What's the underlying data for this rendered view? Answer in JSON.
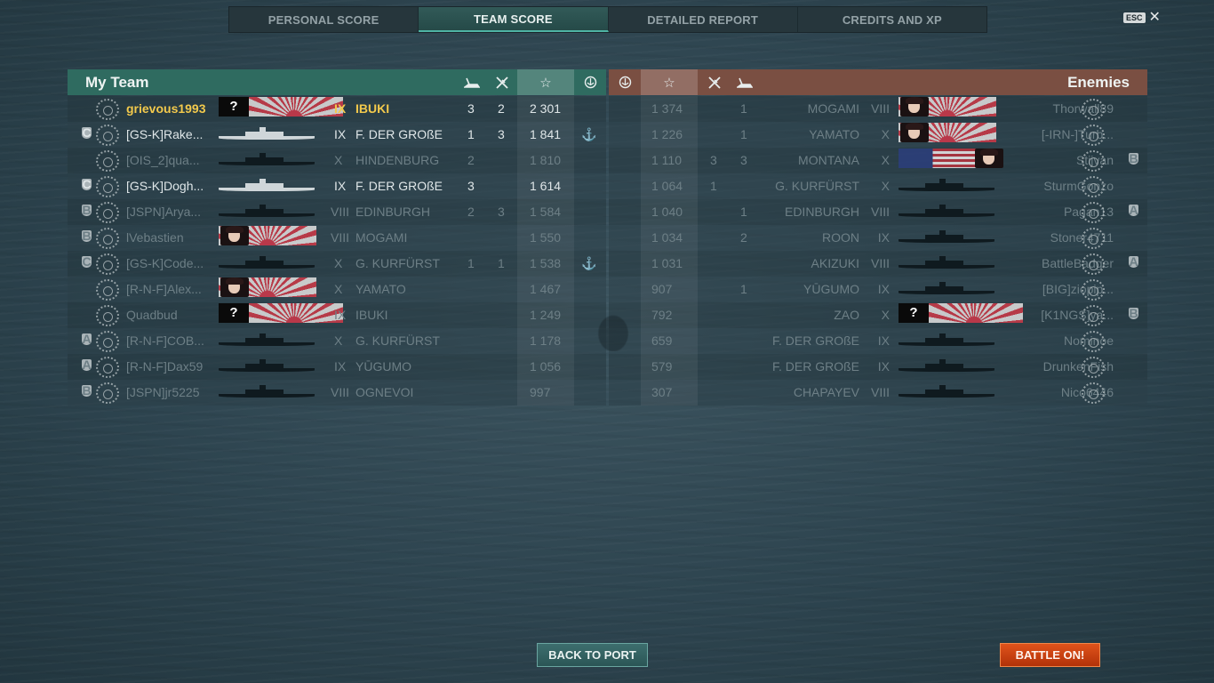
{
  "tabs": [
    {
      "label": "PERSONAL SCORE"
    },
    {
      "label": "TEAM SCORE"
    },
    {
      "label": "DETAILED REPORT"
    },
    {
      "label": "CREDITS AND XP"
    }
  ],
  "esc_key": "ESC",
  "close_glyph": "✕",
  "my_team": {
    "title": "My Team",
    "header_icons": [
      "torpedo-ship-icon",
      "plane-destroyed-icon",
      "star-icon",
      "base-capture-icon"
    ],
    "rows": [
      {
        "division": "",
        "name": "grievous1993",
        "tier": "IX",
        "ship": "IBUKI",
        "a": "3",
        "b": "2",
        "score": "2 301",
        "anchor": "",
        "alive": true,
        "me": true,
        "visual": "unknown-flag"
      },
      {
        "division": "C",
        "name": "[GS-K]Rake...",
        "tier": "IX",
        "ship": "F. DER GROßE",
        "a": "1",
        "b": "3",
        "score": "1 841",
        "anchor": "⚓",
        "alive": true,
        "visual": "silhouette"
      },
      {
        "division": "",
        "name": "[OIS_2]qua...",
        "tier": "X",
        "ship": "HINDENBURG",
        "a": "2",
        "b": "",
        "score": "1 810",
        "anchor": "",
        "alive": false,
        "visual": "silhouette"
      },
      {
        "division": "C",
        "name": "[GS-K]Dogh...",
        "tier": "IX",
        "ship": "F. DER GROßE",
        "a": "3",
        "b": "",
        "score": "1 614",
        "anchor": "",
        "alive": true,
        "visual": "silhouette"
      },
      {
        "division": "B",
        "name": "[JSPN]Arya...",
        "tier": "VIII",
        "ship": "EDINBURGH",
        "a": "2",
        "b": "3",
        "score": "1 584",
        "anchor": "",
        "alive": false,
        "visual": "silhouette"
      },
      {
        "division": "B",
        "name": "lVebastien",
        "tier": "VIII",
        "ship": "MOGAMI",
        "a": "",
        "b": "",
        "score": "1 550",
        "anchor": "",
        "alive": false,
        "visual": "portrait-flag"
      },
      {
        "division": "C",
        "name": "[GS-K]Code...",
        "tier": "X",
        "ship": "G. KURFÜRST",
        "a": "1",
        "b": "1",
        "score": "1 538",
        "anchor": "⚓",
        "alive": false,
        "visual": "silhouette"
      },
      {
        "division": "",
        "name": "[R-N-F]Alex...",
        "tier": "X",
        "ship": "YAMATO",
        "a": "",
        "b": "",
        "score": "1 467",
        "anchor": "",
        "alive": false,
        "visual": "portrait-flag"
      },
      {
        "division": "",
        "name": "Quadbud",
        "tier": "IX",
        "ship": "IBUKI",
        "a": "",
        "b": "",
        "score": "1 249",
        "anchor": "",
        "alive": false,
        "visual": "unknown-flag"
      },
      {
        "division": "A",
        "name": "[R-N-F]COB...",
        "tier": "X",
        "ship": "G. KURFÜRST",
        "a": "",
        "b": "",
        "score": "1 178",
        "anchor": "",
        "alive": false,
        "visual": "silhouette"
      },
      {
        "division": "A",
        "name": "[R-N-F]Dax59",
        "tier": "IX",
        "ship": "YŪGUMO",
        "a": "",
        "b": "",
        "score": "1 056",
        "anchor": "",
        "alive": false,
        "visual": "silhouette"
      },
      {
        "division": "B",
        "name": "[JSPN]jr5225",
        "tier": "VIII",
        "ship": "OGNEVOI",
        "a": "",
        "b": "",
        "score": "997",
        "anchor": "",
        "alive": false,
        "visual": "silhouette"
      }
    ]
  },
  "enemies": {
    "title": "Enemies",
    "rows": [
      {
        "score": "1 374",
        "b": "",
        "a": "1",
        "ship": "MOGAMI",
        "tier": "VIII",
        "name": "Thorwall89",
        "division": "",
        "alive": false,
        "visual": "portrait-flag"
      },
      {
        "score": "1 226",
        "b": "",
        "a": "1",
        "ship": "YAMATO",
        "tier": "X",
        "name": "[-IRN-]Turb...",
        "division": "",
        "alive": false,
        "visual": "portrait-flag"
      },
      {
        "score": "1 110",
        "b": "3",
        "a": "3",
        "ship": "MONTANA",
        "tier": "X",
        "name": "Stijvan",
        "division": "B",
        "alive": false,
        "visual": "us-flag"
      },
      {
        "score": "1 064",
        "b": "1",
        "a": "",
        "ship": "G. KURFÜRST",
        "tier": "X",
        "name": "SturmGonzo",
        "division": "",
        "alive": false,
        "visual": "silhouette"
      },
      {
        "score": "1 040",
        "b": "",
        "a": "1",
        "ship": "EDINBURGH",
        "tier": "VIII",
        "name": "Pagan13",
        "division": "A",
        "alive": false,
        "visual": "silhouette"
      },
      {
        "score": "1 034",
        "b": "",
        "a": "2",
        "ship": "ROON",
        "tier": "IX",
        "name": "Stoner4711",
        "division": "",
        "alive": false,
        "visual": "silhouette"
      },
      {
        "score": "1 031",
        "b": "",
        "a": "",
        "ship": "AKIZUKI",
        "tier": "VIII",
        "name": "BattleBadger",
        "division": "A",
        "alive": false,
        "visual": "silhouette"
      },
      {
        "score": "907",
        "b": "",
        "a": "1",
        "ship": "YŪGUMO",
        "tier": "IX",
        "name": "[BIG]ziopip...",
        "division": "",
        "alive": false,
        "visual": "silhouette"
      },
      {
        "score": "792",
        "b": "",
        "a": "",
        "ship": "ZAO",
        "tier": "X",
        "name": "[K1NGS]ya...",
        "division": "B",
        "alive": false,
        "visual": "unknown-flag"
      },
      {
        "score": "659",
        "b": "",
        "a": "",
        "ship": "F. DER GROßE",
        "tier": "IX",
        "name": "Nominoe",
        "division": "",
        "alive": false,
        "visual": "silhouette"
      },
      {
        "score": "579",
        "b": "",
        "a": "",
        "ship": "F. DER GROßE",
        "tier": "IX",
        "name": "DrunkenFish",
        "division": "",
        "alive": false,
        "visual": "silhouette"
      },
      {
        "score": "307",
        "b": "",
        "a": "",
        "ship": "CHAPAYEV",
        "tier": "VIII",
        "name": "Nico6446",
        "division": "",
        "alive": false,
        "visual": "silhouette"
      }
    ]
  },
  "buttons": {
    "back_to_port": "BACK TO PORT",
    "battle_on": "BATTLE ON!"
  },
  "colors": {
    "my_team": "#2f6b60",
    "enemies": "#7a4f42",
    "highlight": "#f2c94c",
    "battle": "#d0430f"
  }
}
